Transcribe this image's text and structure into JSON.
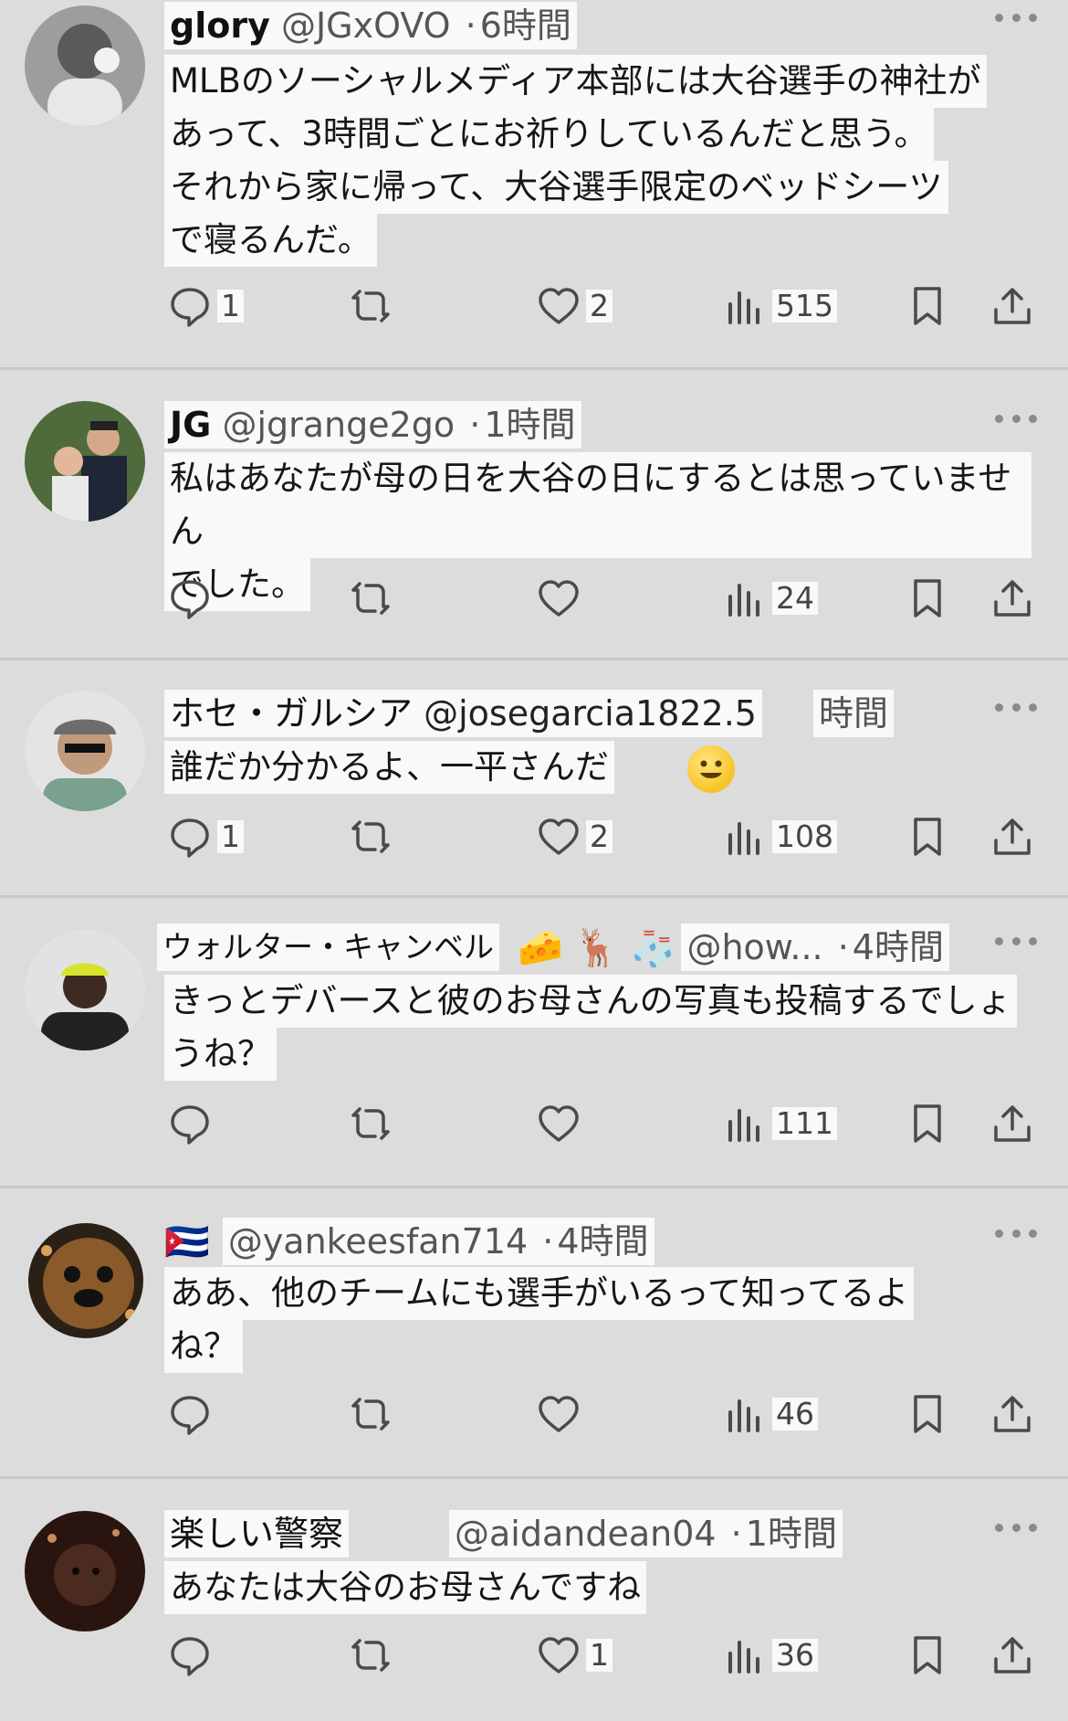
{
  "posts": [
    {
      "name": "glory",
      "handle": "@JGxOVO",
      "dot": "·",
      "time": "6時間",
      "avatar_icon": "avatar-photo-icon",
      "lines": [
        "MLBのソーシャルメディア本部には大谷選手の神社が",
        "あって、3時間ごとにお祈りしているんだと思う。",
        "それから家に帰って、大谷選手限定のベッドシーツ",
        "で寝るんだ。"
      ],
      "replies": "1",
      "reposts": "",
      "likes": "2",
      "views": "515"
    },
    {
      "name": "JG",
      "handle": "@jgrange2go",
      "dot": "·",
      "time": "1時間",
      "avatar_icon": "avatar-photo-icon",
      "lines": [
        "私はあなたが母の日を大谷の日にするとは思っていません",
        "でした。"
      ],
      "replies": "",
      "reposts": "",
      "likes": "",
      "views": "24"
    },
    {
      "name": "ホセ・ガルシア",
      "handle": "@josegarcia1822.5",
      "dot": "",
      "time": "時間",
      "avatar_icon": "avatar-photo-icon",
      "lines": [
        "誰だか分かるよ、一平さんだ"
      ],
      "emoji": "smiley-emoji",
      "replies": "1",
      "reposts": "",
      "likes": "2",
      "views": "108"
    },
    {
      "name": "ウォルター・キャンベル",
      "handle": "@how...",
      "dot": "·",
      "time": "4時間",
      "avatar_icon": "avatar-photo-icon",
      "name_emojis": [
        "🧀",
        "🦌",
        "🧦"
      ],
      "lines": [
        "きっとデバースと彼のお母さんの写真も投稿するでしょ",
        "うね？"
      ],
      "replies": "",
      "reposts": "",
      "likes": "",
      "views": "111"
    },
    {
      "name": "",
      "flag": "🇨🇺",
      "handle": "@yankeesfan714",
      "dot": "·",
      "time": "4時間",
      "avatar_icon": "avatar-photo-icon",
      "lines": [
        "ああ、他のチームにも選手がいるって知ってるよ",
        "ね？"
      ],
      "replies": "",
      "reposts": "",
      "likes": "",
      "views": "46"
    },
    {
      "name": "楽しい警察",
      "handle": "@aidandean04",
      "dot": "·",
      "time": "1時間",
      "avatar_icon": "avatar-photo-icon",
      "lines": [
        "あなたは大谷のお母さんですね"
      ],
      "replies": "",
      "reposts": "",
      "likes": "1",
      "views": "36"
    }
  ],
  "colors": {
    "icon": "#4a4a4a",
    "background": "#dcdcdc",
    "divider": "#c7c7c7"
  }
}
